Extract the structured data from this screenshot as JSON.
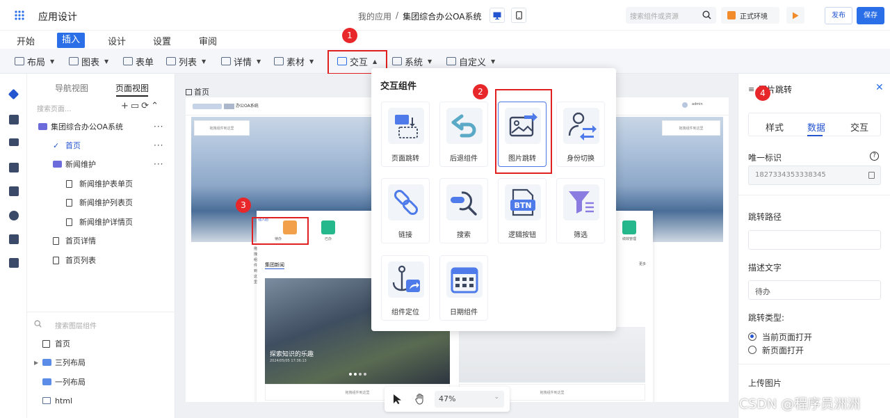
{
  "app": {
    "title": "应用设计"
  },
  "breadcrumb": {
    "parent": "我的应用",
    "separator": "/",
    "current": "集团综合办公OA系统"
  },
  "header": {
    "search_placeholder": "搜索组件或资源",
    "env_label": "正式环境",
    "publish_label": "发布",
    "save_label": "保存",
    "brand_color": "#2b6fe8"
  },
  "menu": {
    "tabs": [
      "开始",
      "插入",
      "设计",
      "设置",
      "审阅"
    ],
    "active": "插入"
  },
  "toolbar": {
    "items": [
      {
        "label": "布局",
        "icon": "layout-icon"
      },
      {
        "label": "图表",
        "icon": "chart-icon"
      },
      {
        "label": "表单",
        "icon": "form-icon"
      },
      {
        "label": "列表",
        "icon": "list-icon"
      },
      {
        "label": "详情",
        "icon": "detail-icon"
      },
      {
        "label": "素材",
        "icon": "image-icon"
      },
      {
        "label": "交互",
        "icon": "interaction-icon"
      },
      {
        "label": "系统",
        "icon": "system-icon"
      },
      {
        "label": "自定义",
        "icon": "custom-icon"
      }
    ]
  },
  "markers": [
    "1",
    "2",
    "3",
    "4"
  ],
  "left_panel": {
    "tabs": [
      "导航视图",
      "页面视图"
    ],
    "active_tab": "页面视图",
    "search_placeholder": "搜索页面...",
    "tree": [
      {
        "label": "集团综合办公OA系统",
        "type": "folder",
        "level": 0,
        "more": "···"
      },
      {
        "label": "首页",
        "type": "page-selected",
        "level": 1,
        "more": "···"
      },
      {
        "label": "新闻维护",
        "type": "folder",
        "level": 1,
        "more": "···"
      },
      {
        "label": "新闻维护表单页",
        "type": "doc",
        "level": 2
      },
      {
        "label": "新闻维护列表页",
        "type": "doc",
        "level": 2
      },
      {
        "label": "新闻维护详情页",
        "type": "doc",
        "level": 2
      },
      {
        "label": "首页详情",
        "type": "doc",
        "level": 1
      },
      {
        "label": "首页列表",
        "type": "doc",
        "level": 1
      }
    ],
    "component_search_placeholder": "搜索图层组件",
    "layers": [
      {
        "label": "首页",
        "icon": "page-icon"
      },
      {
        "label": "三列布局",
        "icon": "layout-icon"
      },
      {
        "label": "一列布局",
        "icon": "layout-icon"
      },
      {
        "label": "html",
        "icon": "html-icon"
      }
    ]
  },
  "canvas": {
    "page_label": "首页",
    "site_name": "办公OA系统",
    "user": "admin",
    "placeholder": "拖拽组件到这里",
    "todo_label": "待办",
    "done_label": "已办",
    "perf_label": "绩效管理",
    "insert_label": "插入后",
    "more_label": "更多",
    "news_title": "集团新闻",
    "news_caption": "探索知识的乐趣",
    "news_date": "2024/05/05 17:36:13"
  },
  "zoom": {
    "level": "47%"
  },
  "popup": {
    "title": "交互组件",
    "items": [
      {
        "label": "页面跳转",
        "icon": "page-jump-icon"
      },
      {
        "label": "后退组件",
        "icon": "back-icon"
      },
      {
        "label": "图片跳转",
        "icon": "image-jump-icon",
        "selected": true
      },
      {
        "label": "身份切换",
        "icon": "identity-switch-icon"
      },
      {
        "label": "链接",
        "icon": "link-icon"
      },
      {
        "label": "搜索",
        "icon": "search-icon"
      },
      {
        "label": "逻辑按钮",
        "icon": "logic-button-icon"
      },
      {
        "label": "筛选",
        "icon": "filter-icon"
      },
      {
        "label": "组件定位",
        "icon": "anchor-icon"
      },
      {
        "label": "日期组件",
        "icon": "calendar-icon"
      }
    ],
    "btn_glyph": "BTN"
  },
  "right_panel": {
    "title": "图片跳转",
    "tabs": [
      "样式",
      "数据",
      "交互"
    ],
    "active_tab": "数据",
    "id_label": "唯一标识",
    "id_value": "1827334353338345",
    "path_label": "跳转路径",
    "path_value": "",
    "desc_label": "描述文字",
    "desc_value": "待办",
    "type_label": "跳转类型:",
    "type_options": [
      "当前页面打开",
      "新页面打开"
    ],
    "type_selected": "当前页面打开",
    "upload_label": "上传图片"
  },
  "watermark": "CSDN @程序员洲洲"
}
